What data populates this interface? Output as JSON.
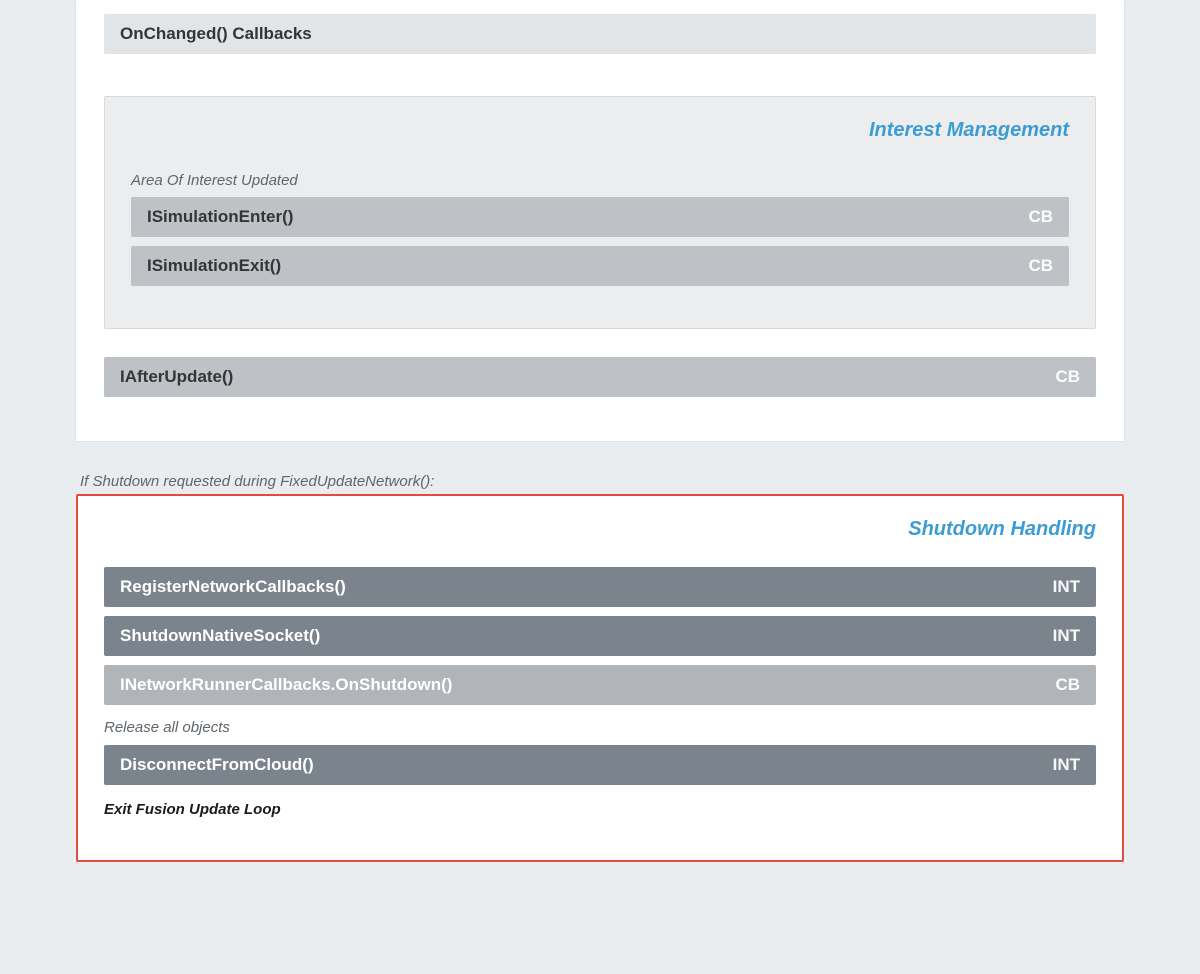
{
  "top": {
    "onchanged_bar": "OnChanged() Callbacks",
    "interest": {
      "title": "Interest Management",
      "note": "Area Of Interest Updated",
      "enter": {
        "label": "ISimulationEnter()",
        "badge": "CB"
      },
      "exit": {
        "label": "ISimulationExit()",
        "badge": "CB"
      }
    },
    "after_update": {
      "label": "IAfterUpdate()",
      "badge": "CB"
    }
  },
  "shutdown_note": "If Shutdown requested during FixedUpdateNetwork():",
  "shutdown": {
    "title": "Shutdown Handling",
    "register": {
      "label": "RegisterNetworkCallbacks()",
      "badge": "INT"
    },
    "native": {
      "label": "ShutdownNativeSocket()",
      "badge": "INT"
    },
    "onshutdown": {
      "label": "INetworkRunnerCallbacks.OnShutdown()",
      "badge": "CB"
    },
    "release_note": "Release all objects",
    "disconnect": {
      "label": "DisconnectFromCloud()",
      "badge": "INT"
    },
    "exit_note": "Exit Fusion Update Loop"
  }
}
